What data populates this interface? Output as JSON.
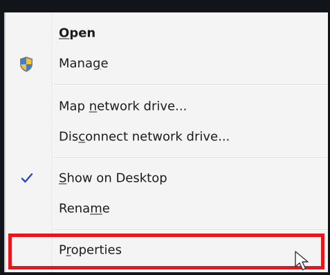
{
  "menu": {
    "items": [
      {
        "id": "open",
        "pre": "",
        "u": "O",
        "post": "pen",
        "bold": true
      },
      {
        "id": "manage",
        "pre": "Mana",
        "u": "g",
        "post": "e",
        "icon": "uac-shield-icon"
      },
      {
        "id": "map-network-drive",
        "pre": "Map ",
        "u": "n",
        "post": "etwork drive..."
      },
      {
        "id": "disconnect-network-drive",
        "pre": "Dis",
        "u": "c",
        "post": "onnect network drive..."
      },
      {
        "id": "show-on-desktop",
        "pre": "",
        "u": "S",
        "post": "how on Desktop",
        "checked": true,
        "icon": "checkmark-icon"
      },
      {
        "id": "rename",
        "pre": "Rena",
        "u": "m",
        "post": "e"
      },
      {
        "id": "properties",
        "pre": "P",
        "u": "r",
        "post": "operties",
        "highlighted": true
      }
    ]
  },
  "colors": {
    "highlight": "#e8161a",
    "checkmark": "#1f4fb8"
  }
}
